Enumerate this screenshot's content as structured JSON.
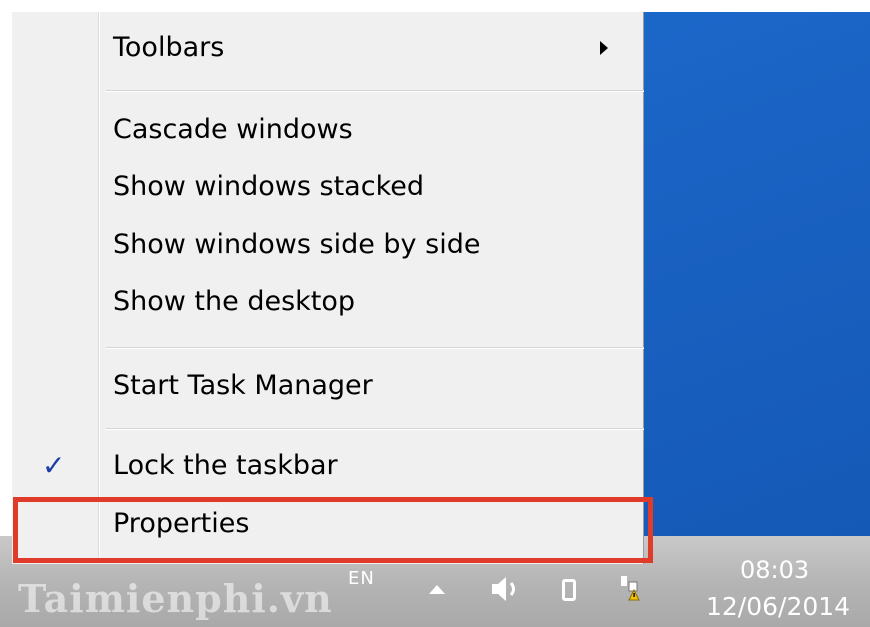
{
  "menu": {
    "toolbars": "Toolbars",
    "cascade": "Cascade windows",
    "stacked": "Show windows stacked",
    "side_by_side": "Show windows side by side",
    "show_desktop": "Show the desktop",
    "task_manager": "Start Task Manager",
    "lock_taskbar": "Lock the taskbar",
    "lock_checked": true,
    "check_mark": "✓",
    "properties": "Properties"
  },
  "tray": {
    "language": "EN",
    "time": "08:03",
    "date": "12/06/2014",
    "icons": [
      "show-hidden-icons-icon",
      "volume-icon",
      "battery-icon",
      "network-warning-icon"
    ]
  },
  "watermark": "Taimienphi.vn",
  "colors": {
    "desktop": "#1a63c4",
    "highlight": "#e03a2a",
    "check": "#1a3fa8"
  }
}
